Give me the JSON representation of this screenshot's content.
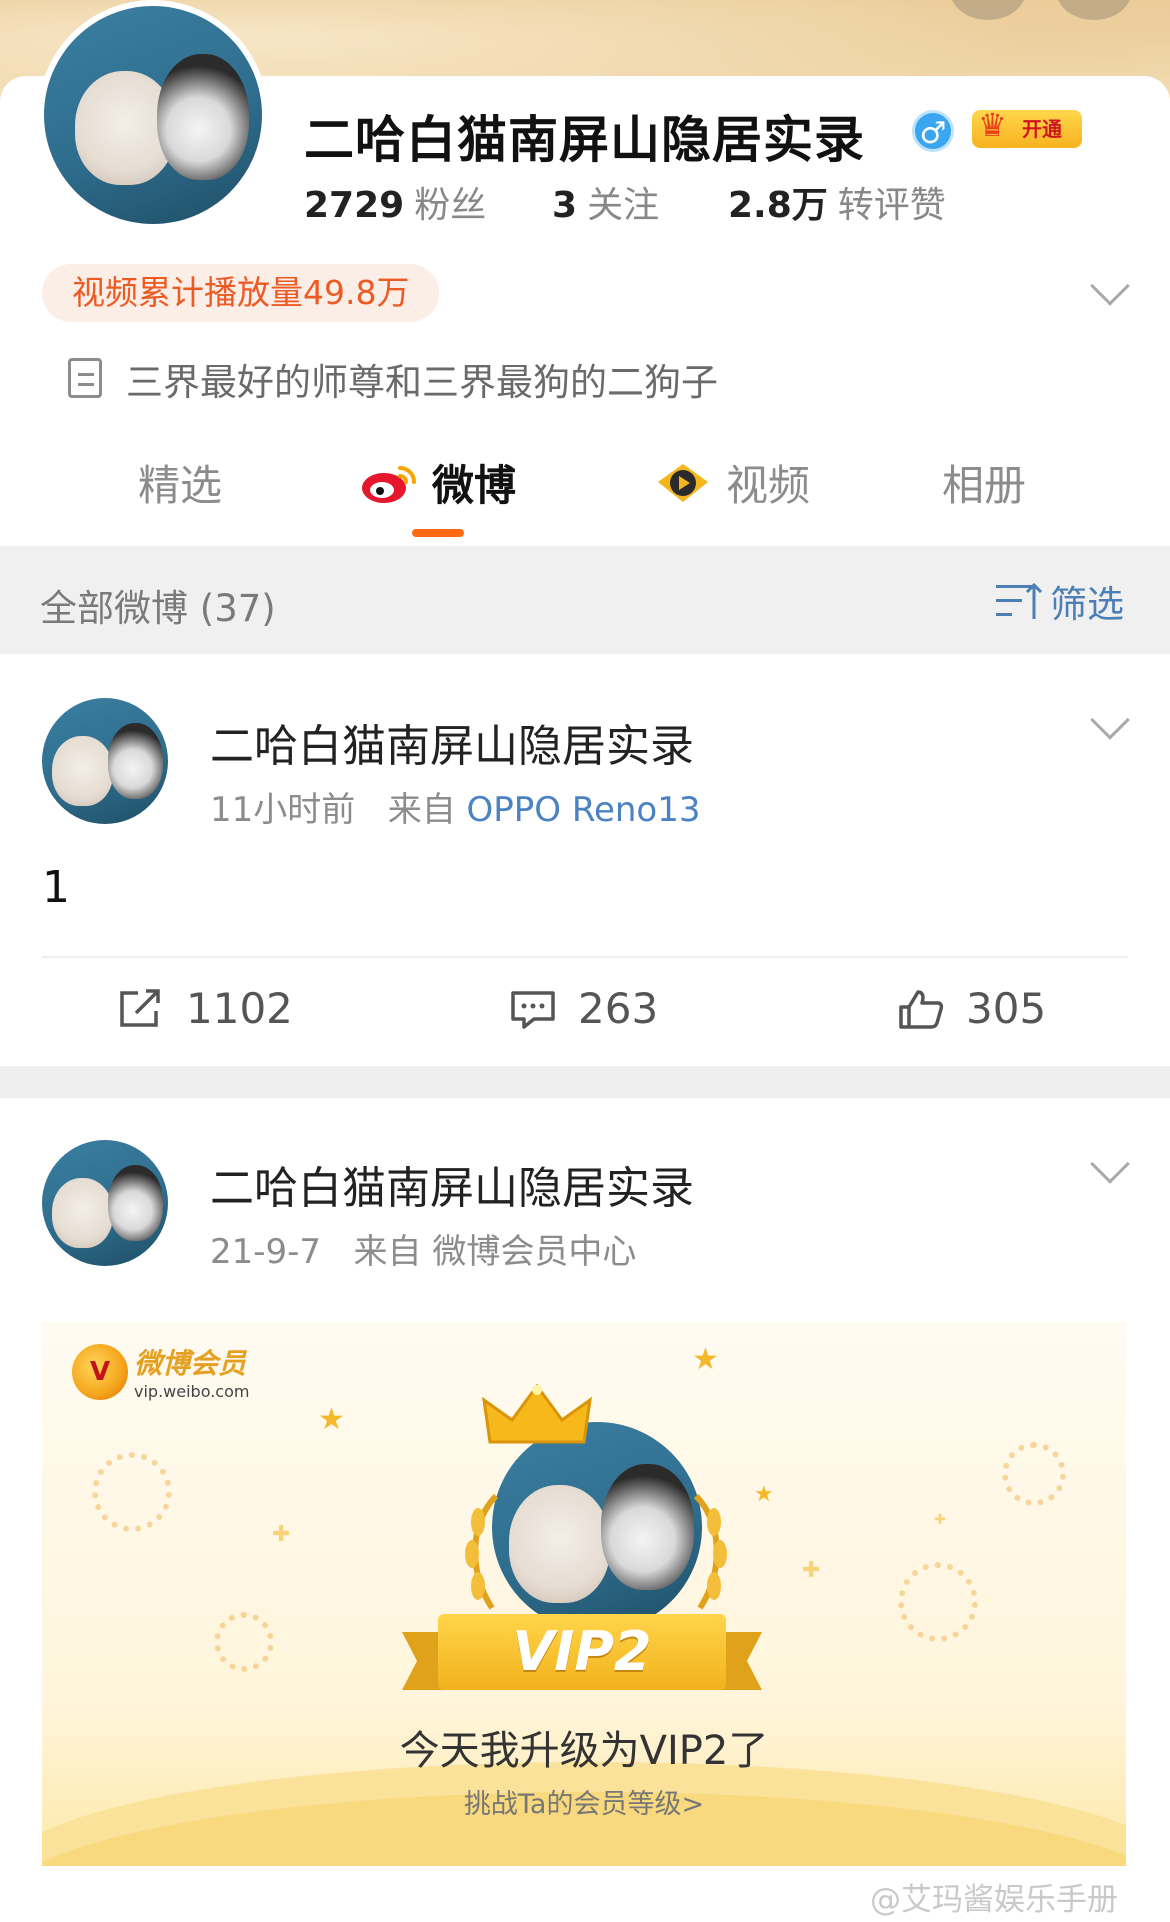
{
  "profile": {
    "name": "二哈白猫南屏山隐居实录",
    "verify_symbol": "♂",
    "vip_open_label": "开通",
    "stats": [
      {
        "value": "2729",
        "label": "粉丝"
      },
      {
        "value": "3",
        "label": "关注"
      },
      {
        "value": "2.8万",
        "label": "转评赞"
      }
    ],
    "video_play_count": "视频累计播放量49.8万",
    "bio": "三界最好的师尊和三界最狗的二狗子"
  },
  "tabs": [
    {
      "label": "精选",
      "active": false
    },
    {
      "label": "微博",
      "active": true
    },
    {
      "label": "视频",
      "active": false
    },
    {
      "label": "相册",
      "active": false
    }
  ],
  "filter_bar": {
    "title": "全部微博 (37)",
    "filter_label": "筛选"
  },
  "posts": [
    {
      "author": "二哈白猫南屏山隐居实录",
      "time": "11小时前",
      "from_prefix": "来自",
      "source": "OPPO Reno13",
      "body": "1",
      "reposts": "1102",
      "comments": "263",
      "likes": "305"
    },
    {
      "author": "二哈白猫南屏山隐居实录",
      "time": "21-9-7",
      "from_prefix": "来自",
      "source": "微博会员中心",
      "card": {
        "brand": "微博会员",
        "brand_url": "vip.weibo.com",
        "level": "VIP2",
        "message": "今天我升级为VIP2了",
        "sub": "挑战Ta的会员等级>"
      }
    }
  ],
  "watermark": "@艾玛酱娱乐手册",
  "colors": {
    "accent_orange": "#ff6a13",
    "link_blue": "#4a82c2",
    "filter_blue": "#4c7fb5",
    "pill_text": "#ee5a24"
  }
}
